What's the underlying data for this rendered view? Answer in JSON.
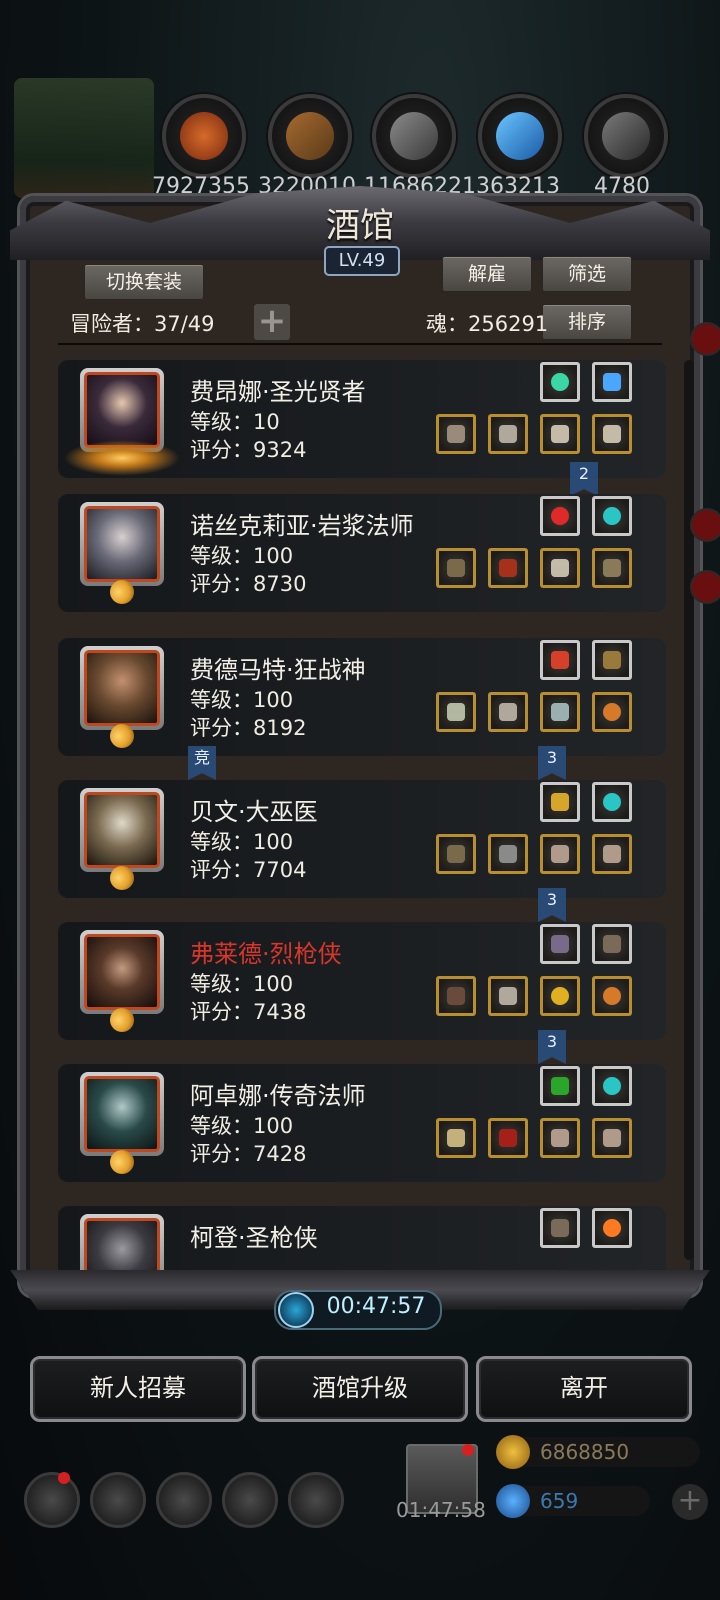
{
  "resources": [
    {
      "icon": "meat-icon",
      "value": "7927355",
      "color": "#b8471a"
    },
    {
      "icon": "wood-icon",
      "value": "3220010",
      "color": "#8a5a2a"
    },
    {
      "icon": "stone-icon",
      "value": "11686221",
      "color": "#6a6a6a"
    },
    {
      "icon": "crystal-icon",
      "value": "363213",
      "color": "#2a8ad6"
    },
    {
      "icon": "iron-icon",
      "value": "4780",
      "color": "#5a5a5a"
    }
  ],
  "panel": {
    "title": "酒馆",
    "level": "LV.49",
    "switch_set_label": "切换套装",
    "dismiss_label": "解雇",
    "filter_label": "筛选",
    "sort_label": "排序",
    "adventurers_label": "冒险者：37/49",
    "soul_label": "魂：256291"
  },
  "heroes": [
    {
      "name": "费昂娜·圣光贤者",
      "level": "等级：10",
      "score": "评分：9324",
      "name_color": "#f3efe6",
      "badge_icon": "sun-emblem-icon",
      "top_items": [
        "green-gem-icon",
        "blue-crystal-icon"
      ],
      "bottom_items": [
        "hammer-icon",
        "chest-armor-icon",
        "gauntlet-icon",
        "gauntlet-icon"
      ],
      "marker": "2"
    },
    {
      "name": "诺丝克莉亚·岩浆法师",
      "level": "等级：100",
      "score": "评分：8730",
      "name_color": "#f3efe6",
      "badge_icon": "moon-icon",
      "top_items": [
        "red-gem-icon",
        "teal-gem-icon"
      ],
      "bottom_items": [
        "staff-icon",
        "red-robe-icon",
        "gauntlet-icon",
        "bow-icon"
      ]
    },
    {
      "name": "费德马特·狂战神",
      "level": "等级：100",
      "score": "评分：8192",
      "name_color": "#f3efe6",
      "badge_icon": "moon-icon",
      "top_items": [
        "scroll-icon",
        "dagger-icon"
      ],
      "bottom_items": [
        "axe-icon",
        "chest-armor-icon",
        "blade-icon",
        "ring-icon"
      ],
      "markers": [
        "竞",
        "3"
      ]
    },
    {
      "name": "贝文·大巫医",
      "level": "等级：100",
      "score": "评分：7704",
      "name_color": "#f3efe6",
      "badge_icon": "moon-icon",
      "top_items": [
        "shield-emblem-icon",
        "teal-gem-icon"
      ],
      "bottom_items": [
        "staff-icon",
        "chest-armor-icon",
        "bracer-icon",
        "bracer-icon"
      ],
      "marker": "3"
    },
    {
      "name": "弗莱德·烈枪侠",
      "level": "等级：100",
      "score": "评分：7438",
      "name_color": "#d8362a",
      "badge_icon": "moon-icon",
      "top_items": [
        "feather-icon",
        "pistol-icon"
      ],
      "bottom_items": [
        "rifle-icon",
        "chest-armor-icon",
        "gold-ring-icon",
        "ring-icon"
      ],
      "marker": "3"
    },
    {
      "name": "阿卓娜·传奇法师",
      "level": "等级：100",
      "score": "评分：7428",
      "name_color": "#f3efe6",
      "badge_icon": "moon-icon",
      "top_items": [
        "green-tome-icon",
        "teal-gem-icon"
      ],
      "bottom_items": [
        "wand-icon",
        "red-cloak-icon",
        "bracer-icon",
        "bracer-icon"
      ]
    },
    {
      "name": "柯登·圣枪侠",
      "name_color": "#f3efe6",
      "badge_icon": "moon-icon",
      "top_items": [
        "pistol-icon",
        "fire-orb-icon"
      ]
    }
  ],
  "timer": "00:47:57",
  "actions": {
    "recruit": "新人招募",
    "upgrade": "酒馆升级",
    "leave": "离开"
  },
  "bottom": {
    "gift_timer": "01:47:58",
    "gold": "6868850",
    "gems": "659"
  }
}
